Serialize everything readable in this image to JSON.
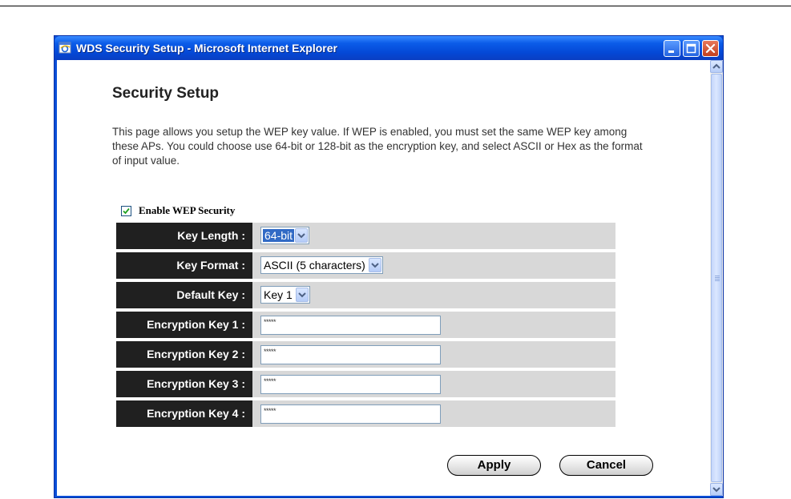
{
  "window": {
    "title": "WDS Security Setup - Microsoft Internet Explorer"
  },
  "page": {
    "title": "Security Setup",
    "description": "This page allows you setup the WEP key value. If WEP is enabled, you must set the same WEP key among these APs. You could choose use 64-bit or 128-bit as the encryption key, and select ASCII or Hex as the format of input value."
  },
  "enable_wep": {
    "label": "Enable WEP Security",
    "checked": true
  },
  "fields": {
    "key_length": {
      "label": "Key Length :",
      "value": "64-bit"
    },
    "key_format": {
      "label": "Key Format :",
      "value": "ASCII (5 characters)"
    },
    "default_key": {
      "label": "Default Key :",
      "value": "Key 1"
    },
    "encryption_key_1": {
      "label": "Encryption Key 1 :",
      "value": "*****"
    },
    "encryption_key_2": {
      "label": "Encryption Key 2 :",
      "value": "*****"
    },
    "encryption_key_3": {
      "label": "Encryption Key 3 :",
      "value": "*****"
    },
    "encryption_key_4": {
      "label": "Encryption Key 4 :",
      "value": "*****"
    }
  },
  "buttons": {
    "apply": "Apply",
    "cancel": "Cancel"
  },
  "icons": {
    "app": "internet-explorer-icon",
    "minimize": "minimize-icon",
    "maximize": "maximize-icon",
    "close": "close-icon"
  }
}
